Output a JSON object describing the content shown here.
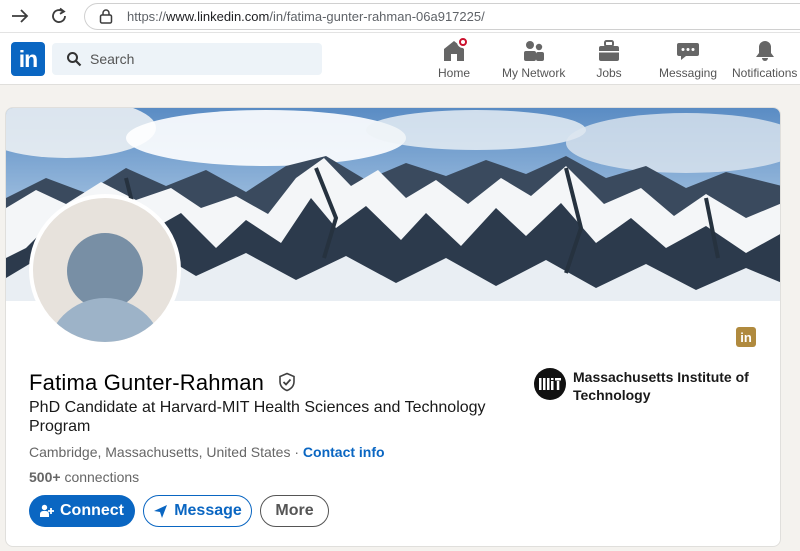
{
  "browser": {
    "url_prefix": "https://",
    "url_domain": "www.linkedin.com",
    "url_path": "/in/fatima-gunter-rahman-06a917225/"
  },
  "header": {
    "logo_text": "in",
    "search_placeholder": "Search",
    "nav": [
      {
        "label": "Home",
        "icon": "home-icon"
      },
      {
        "label": "My Network",
        "icon": "my-network-icon"
      },
      {
        "label": "Jobs",
        "icon": "jobs-icon"
      },
      {
        "label": "Messaging",
        "icon": "messaging-icon"
      },
      {
        "label": "Notifications",
        "icon": "notifications-icon"
      }
    ]
  },
  "profile": {
    "name": "Fatima Gunter-Rahman",
    "headline": "PhD Candidate at Harvard-MIT Health Sciences and Technology Program",
    "location": "Cambridge, Massachusetts, United States",
    "separator": "·",
    "contact_info_label": "Contact info",
    "connections_count": "500+",
    "connections_label": "connections",
    "education": {
      "school": "Massachusetts Institute of Technology",
      "logo_text": "MIT"
    },
    "actions": {
      "connect": "Connect",
      "message": "Message",
      "more": "More"
    },
    "small_logo_text": "in"
  },
  "colors": {
    "brand_blue": "#0a66c2",
    "badge_red": "#cb112d",
    "page_bg": "#f4f2ee"
  }
}
